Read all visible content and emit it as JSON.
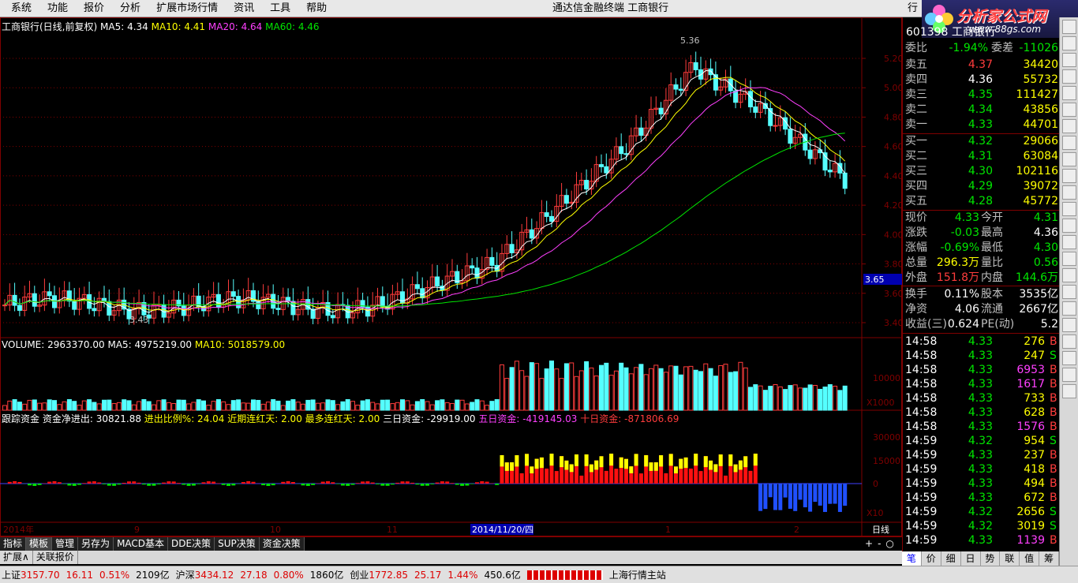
{
  "menu": [
    "系统",
    "功能",
    "报价",
    "分析",
    "扩展市场行情",
    "资讯",
    "工具",
    "帮助"
  ],
  "window_title": "通达信金融终端  工商银行",
  "right_corner_label": "行",
  "logo": {
    "text": "分析家公式网",
    "url_text": "www.88gs.com"
  },
  "main_chart": {
    "header": {
      "name": "工商银行(日线,前复权)",
      "ma5": "MA5: 4.34",
      "ma10": "MA10: 4.41",
      "ma20": "MA20: 4.64",
      "ma60": "MA60: 4.46"
    },
    "y_ticks": [
      "5.20",
      "5.00",
      "4.80",
      "4.60",
      "4.40",
      "4.20",
      "4.00",
      "3.80",
      "3.60",
      "3.40"
    ],
    "high_label": "5.36",
    "low_label": "3.43",
    "current_price_box": "3.65"
  },
  "volume_chart": {
    "header": {
      "volume": "VOLUME: 2963370.00",
      "ma5": "MA5: 4975219.00",
      "ma10": "MA10: 5018579.00"
    },
    "y_tick": "10000",
    "unit": "X1000"
  },
  "capital_chart": {
    "header": {
      "name": "跟踪资金",
      "net": "资金净进出: 30821.88",
      "ratio": "进出比例%: 24.04",
      "recent": "近期连红天: 2.00",
      "most": "最多连红天: 2.00",
      "three": "三日资金: -29919.00",
      "five": "五日资金: -419145.03",
      "ten": "十日资金: -871806.69"
    },
    "y_ticks": [
      "30000",
      "15000",
      "0"
    ],
    "unit": "X10"
  },
  "x_axis": {
    "labels": [
      "2014年",
      "9",
      "10",
      "11",
      "2014/11/20/四",
      "1",
      "2"
    ],
    "period": "日线"
  },
  "zoom_controls": [
    "+",
    "-",
    "○"
  ],
  "bottom_tabs": [
    "指标",
    "模板",
    "管理",
    "另存为",
    "MACD基本",
    "DDE决策",
    "SUP决策",
    "资金决策"
  ],
  "sub_tabs": [
    "扩展∧",
    "关联报价"
  ],
  "right_panel": {
    "code_row": "601398 工商银行",
    "weibi": {
      "label": "委比",
      "val": "-1.94%",
      "label2": "委差",
      "val2": "-11026"
    },
    "asks": [
      {
        "label": "卖五",
        "price": "4.37",
        "vol": "34420"
      },
      {
        "label": "卖四",
        "price": "4.36",
        "vol": "55732"
      },
      {
        "label": "卖三",
        "price": "4.35",
        "vol": "111427"
      },
      {
        "label": "卖二",
        "price": "4.34",
        "vol": "43856"
      },
      {
        "label": "卖一",
        "price": "4.33",
        "vol": "44701"
      }
    ],
    "bids": [
      {
        "label": "买一",
        "price": "4.32",
        "vol": "29066"
      },
      {
        "label": "买二",
        "price": "4.31",
        "vol": "63084"
      },
      {
        "label": "买三",
        "price": "4.30",
        "vol": "102116"
      },
      {
        "label": "买四",
        "price": "4.29",
        "vol": "39072"
      },
      {
        "label": "买五",
        "price": "4.28",
        "vol": "45772"
      }
    ],
    "stats": [
      {
        "l1": "现价",
        "v1": "4.33",
        "l2": "今开",
        "v2": "4.31"
      },
      {
        "l1": "涨跌",
        "v1": "-0.03",
        "l2": "最高",
        "v2": "4.36"
      },
      {
        "l1": "涨幅",
        "v1": "-0.69%",
        "l2": "最低",
        "v2": "4.30"
      },
      {
        "l1": "总量",
        "v1": "296.3万",
        "l2": "量比",
        "v2": "0.56"
      },
      {
        "l1": "外盘",
        "v1": "151.8万",
        "l2": "内盘",
        "v2": "144.6万"
      }
    ],
    "stats2": [
      {
        "l1": "换手",
        "v1": "0.11%",
        "l2": "股本",
        "v2": "3535亿"
      },
      {
        "l1": "净资",
        "v1": "4.06",
        "l2": "流通",
        "v2": "2667亿"
      },
      {
        "l1": "收益(三)",
        "v1": "0.624",
        "l2": "PE(动)",
        "v2": "5.2"
      }
    ],
    "ticks": [
      {
        "t": "14:58",
        "p": "4.33",
        "v": "276",
        "s": "B"
      },
      {
        "t": "14:58",
        "p": "4.33",
        "v": "247",
        "s": "S"
      },
      {
        "t": "14:58",
        "p": "4.33",
        "v": "6953",
        "s": "B"
      },
      {
        "t": "14:58",
        "p": "4.33",
        "v": "1617",
        "s": "B"
      },
      {
        "t": "14:58",
        "p": "4.33",
        "v": "733",
        "s": "B"
      },
      {
        "t": "14:58",
        "p": "4.33",
        "v": "628",
        "s": "B"
      },
      {
        "t": "14:58",
        "p": "4.33",
        "v": "1576",
        "s": "B"
      },
      {
        "t": "14:59",
        "p": "4.32",
        "v": "954",
        "s": "S"
      },
      {
        "t": "14:59",
        "p": "4.33",
        "v": "237",
        "s": "B"
      },
      {
        "t": "14:59",
        "p": "4.33",
        "v": "418",
        "s": "B"
      },
      {
        "t": "14:59",
        "p": "4.33",
        "v": "494",
        "s": "B"
      },
      {
        "t": "14:59",
        "p": "4.33",
        "v": "672",
        "s": "B"
      },
      {
        "t": "14:59",
        "p": "4.32",
        "v": "2656",
        "s": "S"
      },
      {
        "t": "14:59",
        "p": "4.32",
        "v": "3019",
        "s": "S"
      },
      {
        "t": "14:59",
        "p": "4.33",
        "v": "1139",
        "s": "B"
      }
    ],
    "tabs": [
      "笔",
      "价",
      "细",
      "日",
      "势",
      "联",
      "值",
      "筹"
    ]
  },
  "statusbar": {
    "sh_label": "上证",
    "sh_val": "3157.70",
    "sh_chg": "16.11",
    "sh_pct": "0.51%",
    "sh_amt": "2109亿",
    "sz_label": "沪深",
    "sz_val": "3434.12",
    "sz_chg": "27.18",
    "sz_pct": "0.80%",
    "sz_amt": "1860亿",
    "cy_label": "创业",
    "cy_val": "1772.85",
    "cy_chg": "25.17",
    "cy_pct": "1.44%",
    "cy_amt": "450.6亿",
    "station": "上海行情主站"
  },
  "colors": {
    "up": "#ff3c3c",
    "down": "#55ffff",
    "ma5": "#ffffff",
    "ma10": "#ffff00",
    "ma20": "#ff40ff",
    "ma60": "#00e600",
    "grid": "#800000"
  }
}
